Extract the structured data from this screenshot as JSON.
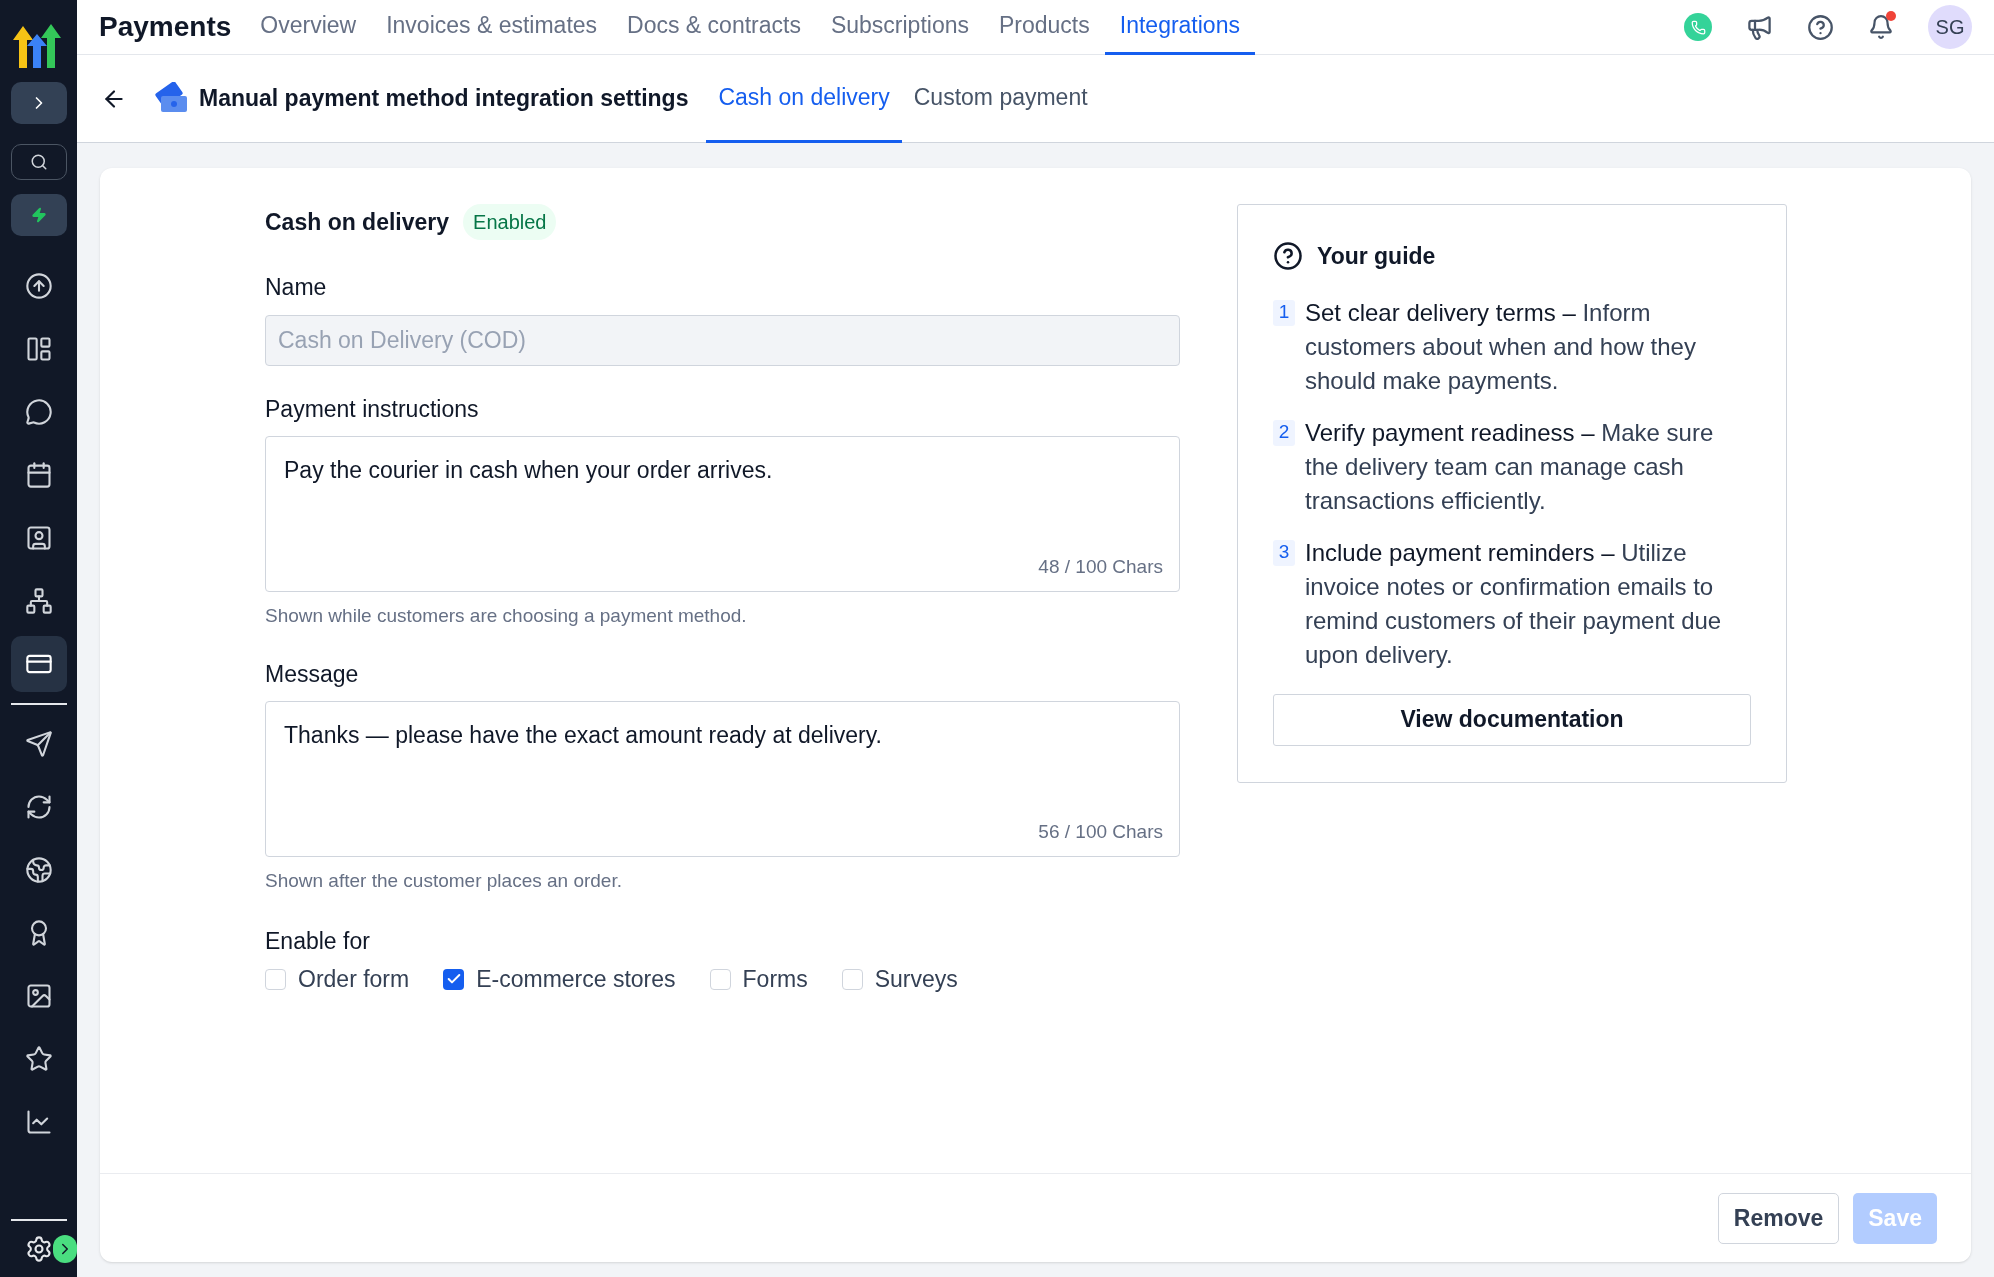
{
  "app": {
    "title": "Payments",
    "avatar": "SG",
    "notification": true
  },
  "nav_tabs": [
    {
      "label": "Overview",
      "selected": false
    },
    {
      "label": "Invoices & estimates",
      "selected": false
    },
    {
      "label": "Docs & contracts",
      "selected": false
    },
    {
      "label": "Subscriptions",
      "selected": false
    },
    {
      "label": "Products",
      "selected": false
    },
    {
      "label": "Integrations",
      "selected": true
    }
  ],
  "sidebar": {
    "items": [
      {
        "kind": "upload",
        "selected": false
      },
      {
        "kind": "layout",
        "selected": false
      },
      {
        "kind": "chat",
        "selected": false
      },
      {
        "kind": "calendar",
        "selected": false
      },
      {
        "kind": "contact",
        "selected": false
      },
      {
        "kind": "network",
        "selected": false
      },
      {
        "kind": "card",
        "selected": true
      },
      {
        "kind": "divider"
      },
      {
        "kind": "send",
        "selected": false
      },
      {
        "kind": "refresh",
        "selected": false
      },
      {
        "kind": "globe",
        "selected": false
      },
      {
        "kind": "award",
        "selected": false
      },
      {
        "kind": "image",
        "selected": false
      },
      {
        "kind": "star",
        "selected": false
      },
      {
        "kind": "chart",
        "selected": false
      }
    ]
  },
  "page_header": {
    "title": "Manual payment method integration settings",
    "tabs": [
      {
        "label": "Cash on delivery",
        "selected": true
      },
      {
        "label": "Custom payment",
        "selected": false
      }
    ]
  },
  "form": {
    "title": "Cash on delivery",
    "status": "Enabled",
    "name": {
      "label": "Name",
      "placeholder": "Cash on Delivery (COD)",
      "disabled": true
    },
    "instructions": {
      "label": "Payment instructions",
      "value": "Pay the courier in cash when your order arrives.",
      "counter": "48 / 100 Chars",
      "help": "Shown while customers are choosing a payment method."
    },
    "message": {
      "label": "Message",
      "value": "Thanks — please have the exact amount ready at delivery.",
      "counter": "56 / 100 Chars",
      "help": "Shown after the customer places an order."
    },
    "enable_for": {
      "label": "Enable for",
      "options": [
        {
          "label": "Order form",
          "checked": false
        },
        {
          "label": "E-commerce stores",
          "checked": true
        },
        {
          "label": "Forms",
          "checked": false
        },
        {
          "label": "Surveys",
          "checked": false
        }
      ]
    }
  },
  "guide": {
    "title": "Your guide",
    "steps": [
      {
        "number": "1",
        "title": "Set clear delivery terms",
        "text": "Inform customers about when and how they should make payments."
      },
      {
        "number": "2",
        "title": "Verify payment readiness",
        "text": "Make sure the delivery team can manage cash transactions efficiently."
      },
      {
        "number": "3",
        "title": "Include payment reminders",
        "text": "Utilize invoice notes or confirmation emails to remind customers of their payment due upon delivery."
      }
    ],
    "separator": "–",
    "button": "View documentation"
  },
  "footer": {
    "buttons": [
      {
        "label": "Remove",
        "kind": "secondary",
        "disabled": false
      },
      {
        "label": "Save",
        "kind": "primary",
        "disabled": true
      }
    ]
  }
}
